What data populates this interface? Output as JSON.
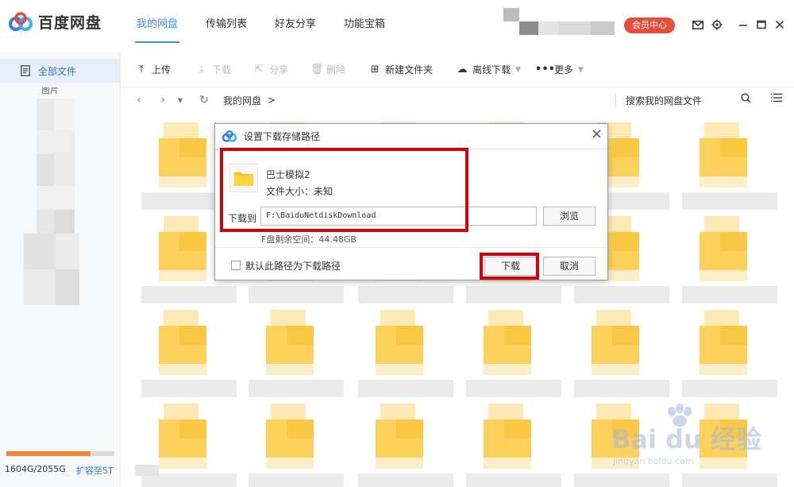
{
  "app": {
    "name": "百度网盘"
  },
  "nav": {
    "tabs": [
      "我的网盘",
      "传输列表",
      "好友分享",
      "功能宝箱"
    ],
    "active_index": 0
  },
  "header": {
    "vip_label": "会员中心"
  },
  "sidebar": {
    "items": [
      {
        "label": "全部文件"
      }
    ],
    "sub_label": "图片",
    "quota": {
      "used_fraction": 0.78,
      "text": "1604G/2055G",
      "expand_label": "扩容至5T"
    }
  },
  "toolbar": {
    "upload": "上传",
    "download": "下载",
    "share": "分享",
    "delete": "删除",
    "new_folder": "新建文件夹",
    "offline": "离线下载",
    "more": "更多"
  },
  "pathbar": {
    "crumb": "我的网盘",
    "separator": ">",
    "search_label": "搜索我的网盘文件"
  },
  "dialog": {
    "title": "设置下载存储路径",
    "file_name": "巴士模拟2",
    "file_size": "文件大小：未知",
    "download_to_label": "下载到",
    "path_value": "F:\\BaiduNetdiskDownload",
    "browse_label": "浏览",
    "free_space": "F盘剩余空间：44.48GB",
    "default_path_label": "默认此路径为下载路径",
    "download_button": "下载",
    "cancel_button": "取消"
  },
  "watermark": {
    "main": "Bai du 经验",
    "sub": "jingyan.baidu.com"
  },
  "colors": {
    "accent": "#3b8cff",
    "vip": "#e74c3c",
    "folder": "#fcd25c",
    "highlight": "#d4000a",
    "quota": "#f08a2c"
  }
}
